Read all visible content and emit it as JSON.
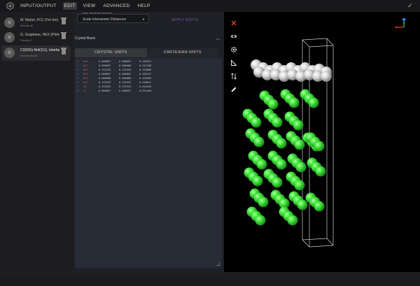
{
  "menubar": {
    "items": [
      {
        "label": "INPUT/OUTPUT",
        "active": false
      },
      {
        "label": "EDIT",
        "active": true
      },
      {
        "label": "VIEW",
        "active": false
      },
      {
        "label": "ADVANCED",
        "active": false
      },
      {
        "label": "HELP",
        "active": false
      }
    ],
    "logo_icon": "app-logo-icon",
    "confirm_icon": "check-icon"
  },
  "materials": [
    {
      "name": "M. Nickel, FCC (Fm-3m)",
      "formula": "Formula: Ni",
      "selected": false
    },
    {
      "name": "G. Graphene, HEX (P6/mmm)",
      "formula": "Formula: C",
      "selected": false
    },
    {
      "name": "C2(001)-Ni4(111), Interface",
      "formula": "Formula: Ni4C8",
      "selected": true
    }
  ],
  "editor_panel": {
    "dropdown_caption": "Scale Interatomic Distances",
    "dropdown_value": "Scale Interatomic Distances",
    "apply_label": "APPLY EDITS",
    "section_title": "Crystal Basis",
    "tabs": [
      {
        "label": "CRYSTAL UNITS",
        "active": true
      },
      {
        "label": "CARTESIAN UNITS",
        "active": false
      }
    ],
    "rows": [
      {
        "ln": "1",
        "el": "Ni0",
        "v1": "0.666667",
        "v2": "0.666667",
        "v3": "0.185941"
      },
      {
        "ln": "2",
        "el": "Ni1",
        "v1": "0.666667",
        "v2": "0.000000",
        "v3": "0.251266"
      },
      {
        "ln": "3",
        "el": "Ni2",
        "v1": "0.333333",
        "v2": "0.333333",
        "v3": "0.320866"
      },
      {
        "ln": "4",
        "el": "Ni3",
        "v1": "0.666667",
        "v2": "0.666667",
        "v3": "0.384437"
      },
      {
        "ln": "5",
        "el": "Ni4",
        "v1": "0.000000",
        "v2": "0.000000",
        "v3": "0.448269"
      },
      {
        "ln": "6",
        "el": "Ni5",
        "v1": "0.333333",
        "v2": "0.333333",
        "v3": "0.548051"
      },
      {
        "ln": "7",
        "el": "C0",
        "v1": "0.333333",
        "v2": "0.333333",
        "v3": "0.616426"
      },
      {
        "ln": "8",
        "el": "C1",
        "v1": "0.666667",
        "v2": "0.666667",
        "v3": "0.615420"
      }
    ]
  },
  "toolbar": {
    "icons": [
      "close-icon",
      "eye-icon",
      "gear-icon",
      "ruler-icon",
      "sort-icon",
      "pencil-icon"
    ]
  },
  "viewer": {
    "atom_colors": {
      "carbon": "#d6d6d6",
      "nickel": "#35e22f"
    },
    "axis_labels": [
      "c",
      "b",
      "a"
    ]
  },
  "colors": {
    "accent_red": "#e0463c",
    "apply": "#6a58b8",
    "axis_x": "#e23b3b",
    "axis_y": "#39d34a",
    "axis_z": "#3b6fe3"
  }
}
